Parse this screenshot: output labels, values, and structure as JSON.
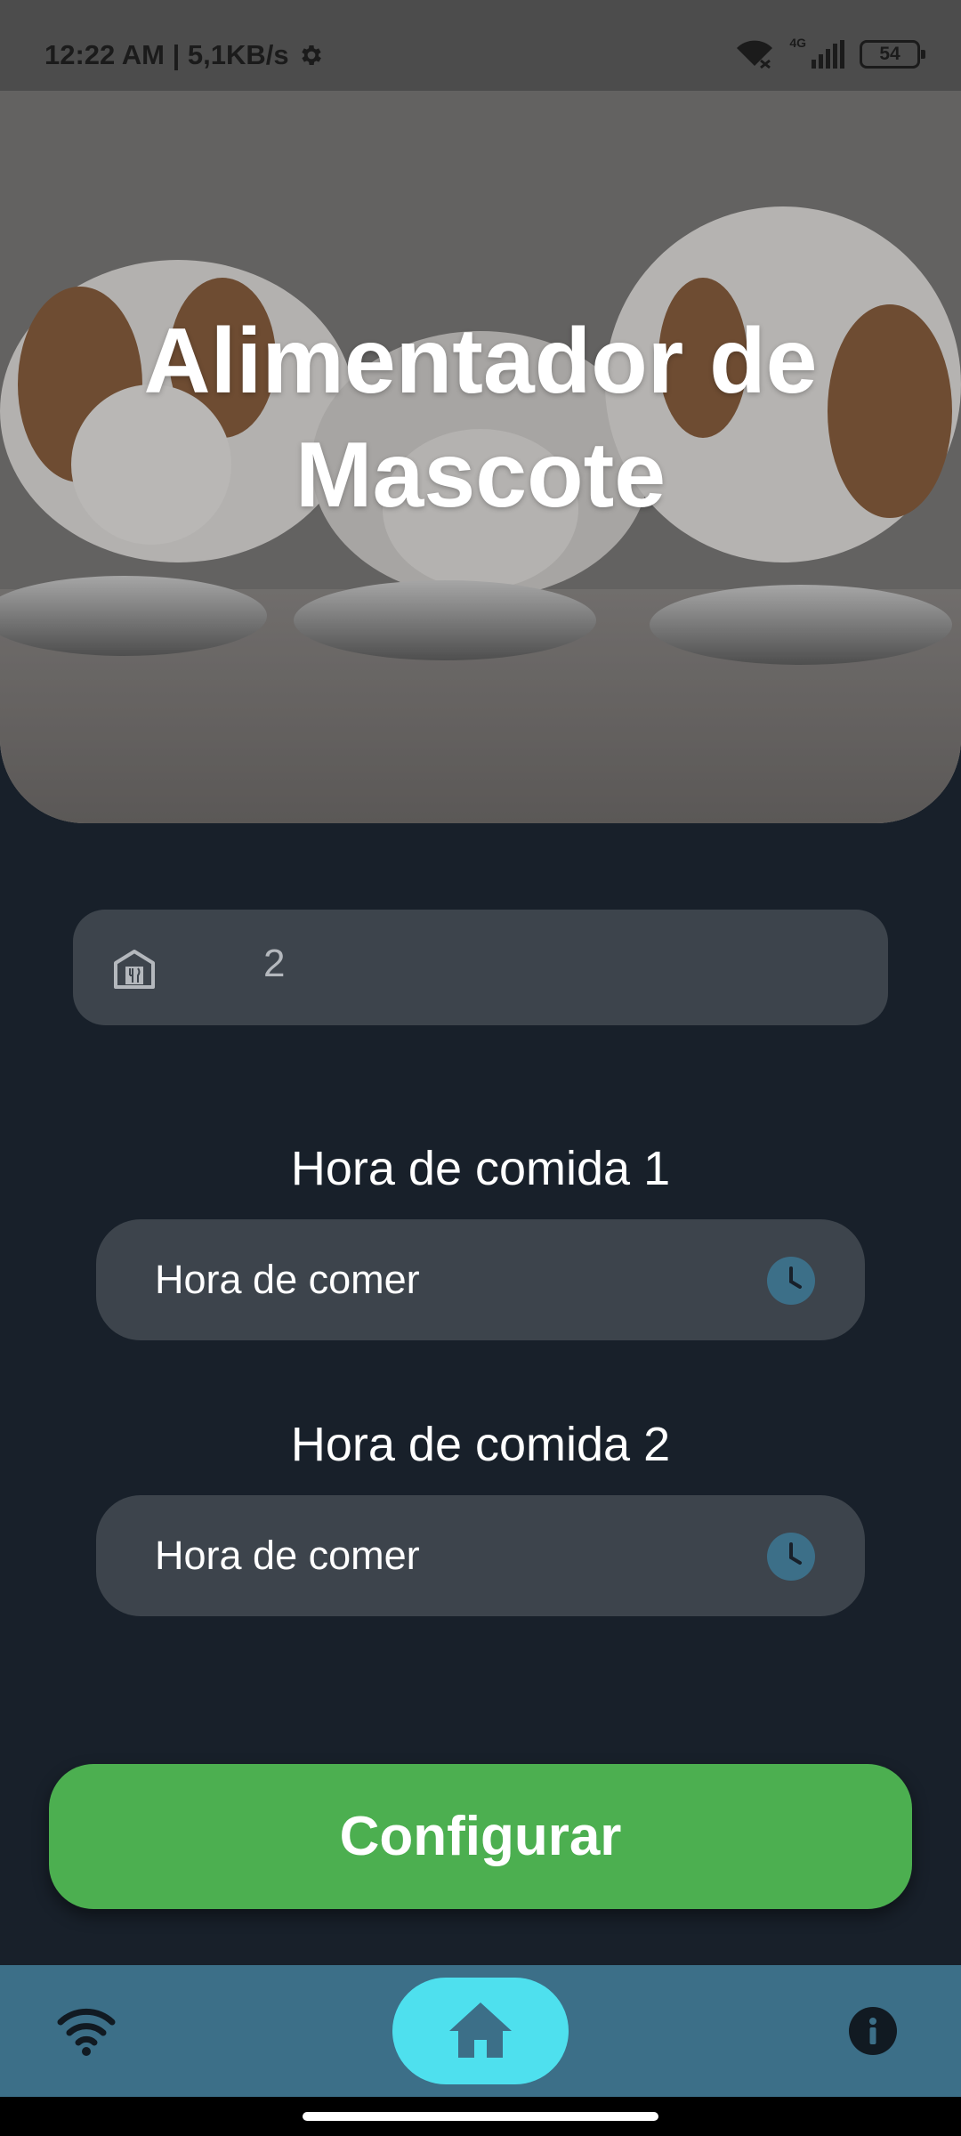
{
  "status_bar": {
    "time_speed": "12:22 AM | 5,1KB/s",
    "network_label": "4G",
    "battery": "54"
  },
  "hero": {
    "title_line1": "Alimentador de",
    "title_line2": "Mascote"
  },
  "food_field": {
    "icon": "food-store-icon",
    "value": "2"
  },
  "meals": [
    {
      "label": "Hora de comida 1",
      "placeholder": "Hora de comer",
      "icon": "clock-icon"
    },
    {
      "label": "Hora de comida 2",
      "placeholder": "Hora de comer",
      "icon": "clock-icon"
    }
  ],
  "configure_button": {
    "label": "Configurar"
  },
  "bottom_nav": {
    "items": [
      {
        "icon": "wifi-icon"
      },
      {
        "icon": "home-icon",
        "active": true
      },
      {
        "icon": "info-icon"
      }
    ]
  },
  "colors": {
    "background": "#18202a",
    "field": "#3d444c",
    "accent_green": "#4caf50",
    "nav_bar": "#3c6f88",
    "nav_active": "#4ee0ee",
    "clock": "#3c6f88"
  }
}
